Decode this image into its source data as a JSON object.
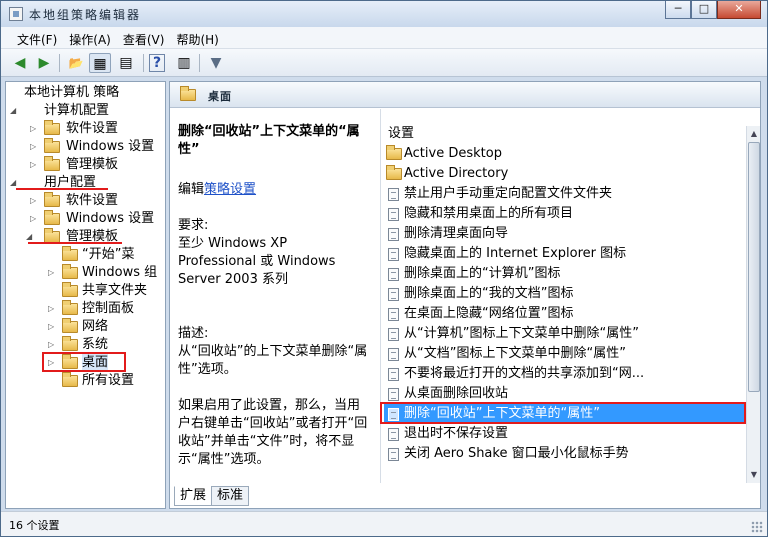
{
  "window": {
    "title": "本地组策略编辑器",
    "controls": {
      "minimize": "─",
      "restore": "□",
      "close": "✕"
    }
  },
  "menu": [
    "文件(F)",
    "操作(A)",
    "查看(V)",
    "帮助(H)"
  ],
  "toolbar": {
    "back": "◀",
    "forward": "▶",
    "up": "📂",
    "show_hide_tree": "▦",
    "export": "▤",
    "help": "?",
    "properties": "▥",
    "filter": "▼"
  },
  "tree": {
    "root": "本地计算机 策略",
    "computer_config": "计算机配置",
    "cc_software": "软件设置",
    "cc_windows": "Windows 设置",
    "cc_admin": "管理模板",
    "user_config": "用户配置",
    "uc_software": "软件设置",
    "uc_windows": "Windows 设置",
    "uc_admin": "管理模板",
    "admin_children": [
      "“开始”菜",
      "Windows 组",
      "共享文件夹",
      "控制面板",
      "网络",
      "系统",
      "桌面",
      "所有设置"
    ]
  },
  "right_header": {
    "title": "桌面"
  },
  "description": {
    "title": "删除“回收站”上下文菜单的“属性”",
    "edit_prefix": "编辑",
    "edit_link": "策略设置",
    "requirements_label": "要求:",
    "requirements": "至少 Windows XP Professional 或 Windows Server 2003 系列",
    "desc_label": "描述:",
    "desc_text": "从“回收站”的上下文菜单删除“属性”选项。",
    "desc_more": "如果启用了此设置，那么，当用户右键单击“回收站”或者打开“回收站”并单击“文件”时，将不显示“属性”选项。"
  },
  "settings": {
    "header": "设置",
    "items": [
      {
        "type": "folder",
        "label": "Active Desktop"
      },
      {
        "type": "folder",
        "label": "Active Directory"
      },
      {
        "type": "policy",
        "label": "禁止用户手动重定向配置文件文件夹"
      },
      {
        "type": "policy",
        "label": "隐藏和禁用桌面上的所有项目"
      },
      {
        "type": "policy",
        "label": "删除清理桌面向导"
      },
      {
        "type": "policy",
        "label": "隐藏桌面上的 Internet Explorer 图标"
      },
      {
        "type": "policy",
        "label": "删除桌面上的“计算机”图标"
      },
      {
        "type": "policy",
        "label": "删除桌面上的“我的文档”图标"
      },
      {
        "type": "policy",
        "label": "在桌面上隐藏“网络位置”图标"
      },
      {
        "type": "policy",
        "label": "从“计算机”图标上下文菜单中删除“属性”"
      },
      {
        "type": "policy",
        "label": "从“文档”图标上下文菜单中删除“属性”"
      },
      {
        "type": "policy",
        "label": "不要将最近打开的文档的共享添加到“网..."
      },
      {
        "type": "policy",
        "label": "从桌面删除回收站"
      },
      {
        "type": "policy",
        "label": "删除“回收站”上下文菜单的“属性”",
        "selected": true
      },
      {
        "type": "policy",
        "label": "退出时不保存设置"
      },
      {
        "type": "policy",
        "label": "关闭 Aero Shake 窗口最小化鼠标手势"
      }
    ]
  },
  "tabs": [
    "扩展",
    "标准"
  ],
  "status": {
    "text": "16 个设置"
  },
  "colors": {
    "selection": "#3399ff",
    "annotation": "#e21b1b",
    "link": "#1f52c8"
  }
}
